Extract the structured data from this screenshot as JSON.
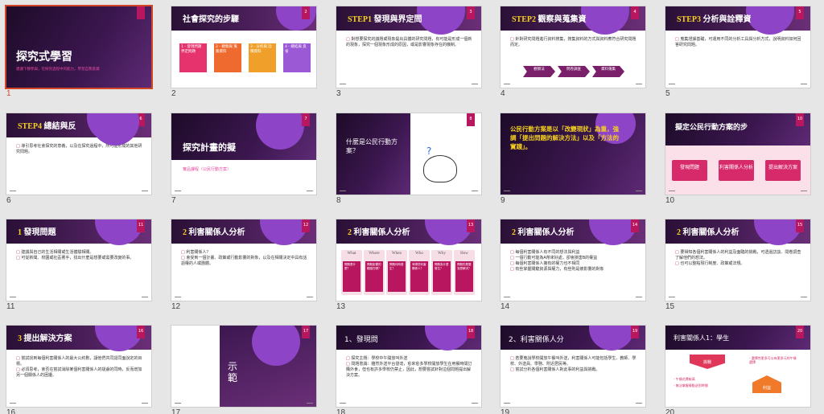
{
  "slides": [
    {
      "num": "1",
      "title": "探究式學習",
      "subtitle": "建議下靜參與，在探究過程中的能力，學習自我意識"
    },
    {
      "num": "2",
      "title": "社會探究的步驟",
      "steps": [
        "1 - 發現問題 界定問題",
        "2 - 觀察與 蒐集資料",
        "3 - 分析與 詮釋資料",
        "4 - 總結與 反省"
      ]
    },
    {
      "num": "3",
      "title_prefix": "STEP1",
      "title": "發現與界定問",
      "bullets": [
        "對想要探究的議題或現象提出具體的研究問題，有可能是形成一個新的現象，探究一個現象形成的原因，或是影響現象存在的機制。"
      ]
    },
    {
      "num": "4",
      "title_prefix": "STEP2",
      "title": "觀察與蒐集資",
      "bullets": [
        "針對研究問題進行資料搜集，搜集資料的方式與資料應符合研究問題而定。"
      ],
      "arrows": [
        "觀察法",
        "問卷調查",
        "資料蒐集"
      ]
    },
    {
      "num": "5",
      "title_prefix": "STEP3",
      "title": "分析與詮釋資",
      "bullets": [
        "蒐集證據基礎，可運用不同的分析工具與分析方式，說明資料如何回答研究問題。"
      ]
    },
    {
      "num": "6",
      "title_prefix": "STEP4",
      "title": "總結與反",
      "bullets": [
        "導引思考社會探究的意義，以及在探究過程中，所可能形成的其他研究問題。"
      ]
    },
    {
      "num": "7",
      "title": "探究計畫的擬",
      "subtitle": "實品課程（公民行動方案）"
    },
    {
      "num": "8",
      "title": "什麼是公民行動方案？"
    },
    {
      "num": "9",
      "quote": "公民行動方案是以「改變現狀」為重，強調「提出問題的解決方法」以及「方法的實踐」。"
    },
    {
      "num": "10",
      "title": "擬定公民行動方案的步",
      "steps": [
        "發現問題",
        "利害關係人分析",
        "提出解決方案"
      ]
    },
    {
      "num": "11",
      "title_prefix": "1",
      "title": "發現問題",
      "bullets": [
        "建議與自己的生活相關或生活體驗相關。",
        "可從新聞、校園或社區著手，找出什麼是想要或需要改變的事。"
      ]
    },
    {
      "num": "12",
      "title_prefix": "2",
      "title": "利害關係人分析",
      "bullets": [
        "利害關係人？",
        "會受到一個計畫、政策或行動影響的對象，以及在相關決定中具有話語權的人或團體。"
      ]
    },
    {
      "num": "13",
      "title_prefix": "2",
      "title": "利害關係人分析",
      "cards": [
        "What",
        "Where",
        "When",
        "Who",
        "Why",
        "How"
      ],
      "card_bodies": [
        "問題是什麼？",
        "問題影響的範圍在哪？",
        "問題何時發生？",
        "有哪些利害關係人？",
        "問題為什麼發生？",
        "問題的是要怎麼解決？"
      ]
    },
    {
      "num": "14",
      "title_prefix": "2",
      "title": "利害關係人分析",
      "bullets": [
        "每個利害關係人有不同的想法與利益",
        "一個行動可能為A帶來好處，卻會損害B的權益",
        "每個利害關係人擁有的權力也不相同",
        "有些掌握關鍵資源與權力，有些則是被影響的對象"
      ]
    },
    {
      "num": "15",
      "title_prefix": "2",
      "title": "利害關係人分析",
      "bullets": [
        "要得知各個利害關係人的利益及面臨的挑戰，可透過訪談、問卷調查了解他們的想法。",
        "也可以整點現行制度、政策或法規。"
      ]
    },
    {
      "num": "16",
      "title_prefix": "3",
      "title": "提出解決方案",
      "bullets": [
        "嘗試找到每個利害關係人的最大公約數，讓他們共同認同面說定的目標。",
        "必須思考，會否在嘗試消除某個利害關係人的疑慮的同時，反而增加另一個關係人的困擾。"
      ]
    },
    {
      "num": "17",
      "title": "示範"
    },
    {
      "num": "18",
      "title": "1、發現問",
      "bullets": [
        "探究主題：學校中午開放叫外送",
        "問題意識：雖然外送平台發達，愈來愈多學校開放學生在用餐時間訂購外食，但也有許多學校仍禁止，因此，想要嘗試針對這個問題提出解決方案。"
      ]
    },
    {
      "num": "19",
      "title": "2、利害關係人分",
      "bullets": [
        "若要蒐說學校開放午餐叫外送，利害關係人可能包括學生、教師、學校、外送員、學務、附近居民等。",
        "嘗試分析各個利害關係人對此事的利益與挑戰。"
      ]
    },
    {
      "num": "20",
      "title": "利害關係人1：學生",
      "labels": [
        "挑戰",
        "利益",
        "- 午餐花費較高",
        "- 無法掌握餐點送到時間",
        "- 選擇性更多可以有更多元的午餐選擇"
      ]
    }
  ],
  "colors": {
    "accent": "#b8165e",
    "selected": "#d24726",
    "purple": "#8e44c7",
    "yellow": "#f5d020"
  }
}
